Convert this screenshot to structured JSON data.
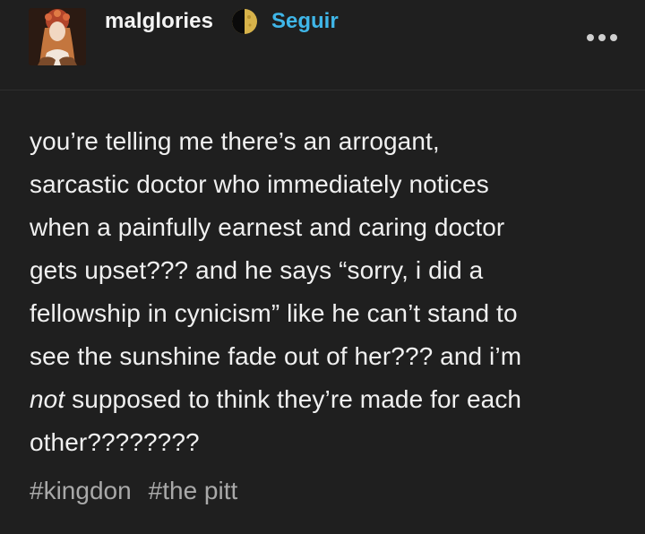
{
  "header": {
    "username": "malglories",
    "follow_label": "Seguir",
    "badge_icon": "moon-phase-icon",
    "more_icon": "more-options-icon"
  },
  "post": {
    "lines": [
      "you’re telling me there’s an arrogant,",
      "sarcastic doctor who immediately notices",
      "when a painfully earnest and caring doctor",
      "gets upset??? and he says “sorry, i did a",
      "fellowship in cynicism” like he can’t stand to",
      "see the sunshine fade out of her??? and i’m"
    ],
    "line7_emphasis": "not",
    "line7_rest": " supposed to think they’re made for each",
    "line8": "other????????"
  },
  "tags": [
    "#kingdon",
    "#the pitt"
  ],
  "colors": {
    "background": "#1f1f1f",
    "text": "#f0f0f0",
    "accent": "#3fb6e8",
    "tag": "#a9a9a9"
  }
}
